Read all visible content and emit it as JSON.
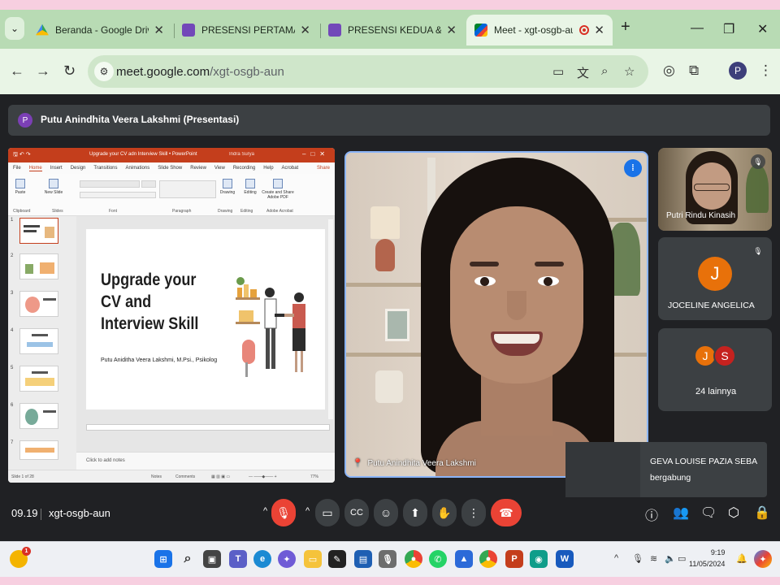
{
  "browser": {
    "tabs": [
      {
        "title": "Beranda - Google Drive",
        "favicon": "google-drive-icon",
        "active": false
      },
      {
        "title": "PRESENSI PERTAMA Soft",
        "favicon": "google-forms-icon",
        "active": false
      },
      {
        "title": "PRESENSI KEDUA & UMP",
        "favicon": "google-forms-icon",
        "active": false
      },
      {
        "title": "Meet - xgt-osgb-aun",
        "favicon": "google-meet-icon",
        "active": true
      }
    ],
    "url_host": "meet.google.com",
    "url_path": "/xgt-osgb-aun",
    "profile_initial": "P"
  },
  "meet": {
    "presenter_initial": "P",
    "presenter_banner": "Putu Anindhita Veera Lakshmi (Presentasi)",
    "main_video_name": "Putu Anindhita Veera Lakshmi",
    "participants": [
      {
        "name": "Putri Rindu Kinasih"
      },
      {
        "name": "JOCELINE ANGELICA",
        "initial": "J"
      },
      {
        "name": "24 lainnya",
        "initials": [
          "J",
          "S"
        ]
      }
    ],
    "toast": {
      "name": "GEVA LOUISE PAZIA SEBA",
      "text": "bergabung"
    },
    "time": "09.19",
    "meeting_code": "xgt-osgb-aun"
  },
  "powerpoint": {
    "window_title": "Upgrade your CV adn Interview Skill • PowerPoint",
    "user": "Indra Surya",
    "menu": [
      "File",
      "Home",
      "Insert",
      "Design",
      "Transitions",
      "Animations",
      "Slide Show",
      "Review",
      "View",
      "Recording",
      "Help",
      "Acrobat"
    ],
    "share": "Share",
    "ribbon_groups": [
      "Clipboard",
      "Slides",
      "Font",
      "Paragraph",
      "Drawing",
      "Editing",
      "Adobe Acrobat"
    ],
    "ribbon_buttons": {
      "paste": "Paste",
      "new_slide": "New Slide",
      "drawing": "Drawing",
      "editing": "Editing",
      "create_pdf": "Create and Share Adobe PDF"
    },
    "slide_numbers": [
      "1",
      "2",
      "3",
      "4",
      "5",
      "6",
      "7"
    ],
    "slide_title": "Upgrade your CV and Interview Skill",
    "slide_subtitle": "Putu Aniditha Veera Lakshmi, M.Psi., Psikolog",
    "notes_placeholder": "Click to add notes",
    "status_slide": "Slide 1 of 28",
    "status_notes": "Notes",
    "status_comments": "Comments",
    "zoom": "77%"
  },
  "taskbar": {
    "time": "9:19",
    "date": "11/05/2024",
    "notification_count": "1"
  },
  "colors": {
    "meet_bg": "#202124",
    "tile_bg": "#3c4043",
    "end_call_red": "#ea4335",
    "tab_strip": "#b8dbb4",
    "powerpoint_accent": "#c43e1c",
    "active_speaker_blue": "#8ab4f8"
  }
}
